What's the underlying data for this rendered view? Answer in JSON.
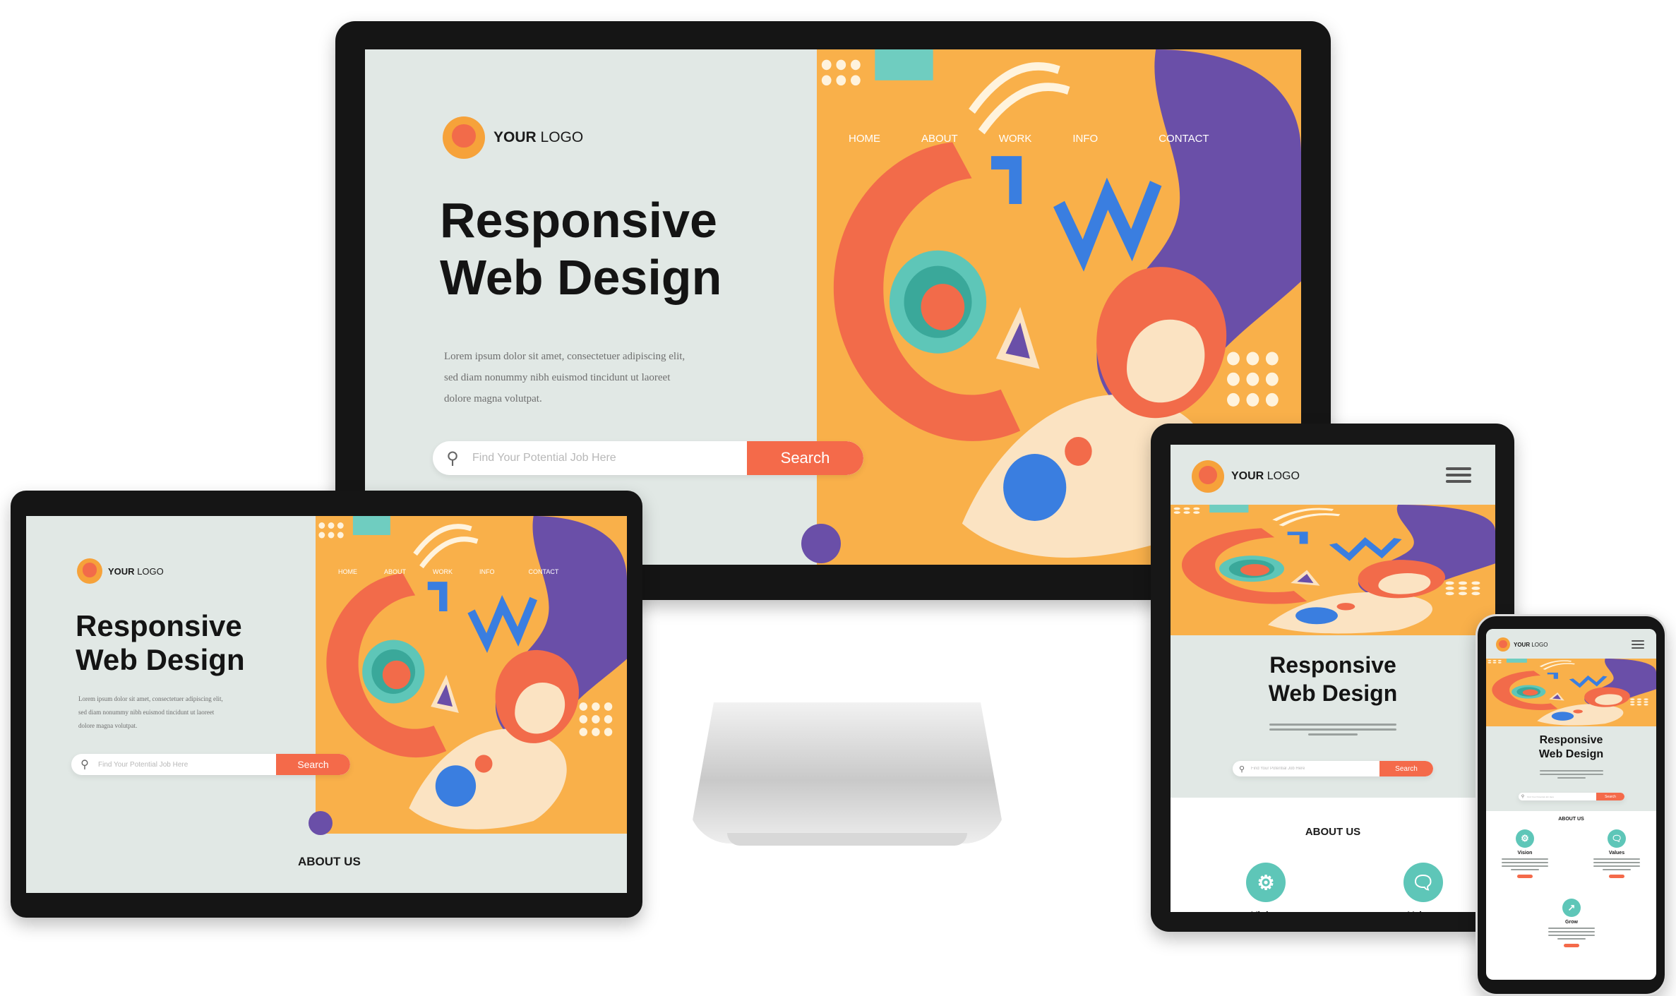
{
  "hero": {
    "logo_bold": "YOUR",
    "logo_light": "LOGO",
    "headline_line1": "Responsive",
    "headline_line2": "Web Design",
    "body_line1": "Lorem ipsum dolor sit amet, consectetuer adipiscing elit,",
    "body_line2": "sed diam nonummy nibh euismod tincidunt ut laoreet",
    "body_line3": "dolore magna volutpat.",
    "search_placeholder": "Find Your Potential Job Here",
    "search_button": "Search"
  },
  "nav": [
    "HOME",
    "ABOUT",
    "WORK",
    "INFO",
    "CONTACT"
  ],
  "about": {
    "title": "ABOUT US",
    "features": [
      "Vision",
      "Values",
      "Grow"
    ]
  },
  "icons": {
    "search": "search-icon",
    "menu": "hamburger-menu-icon",
    "vision": "gear-icon",
    "values": "chat-bubble-icon",
    "grow": "trend-up-icon"
  },
  "colors": {
    "background": "#e1e8e5",
    "accent_orange": "#f6a23a",
    "accent_coral": "#f46a4a",
    "accent_teal": "#5ec6b8",
    "accent_purple": "#6a4fa8",
    "accent_blue": "#3a7ee0"
  }
}
